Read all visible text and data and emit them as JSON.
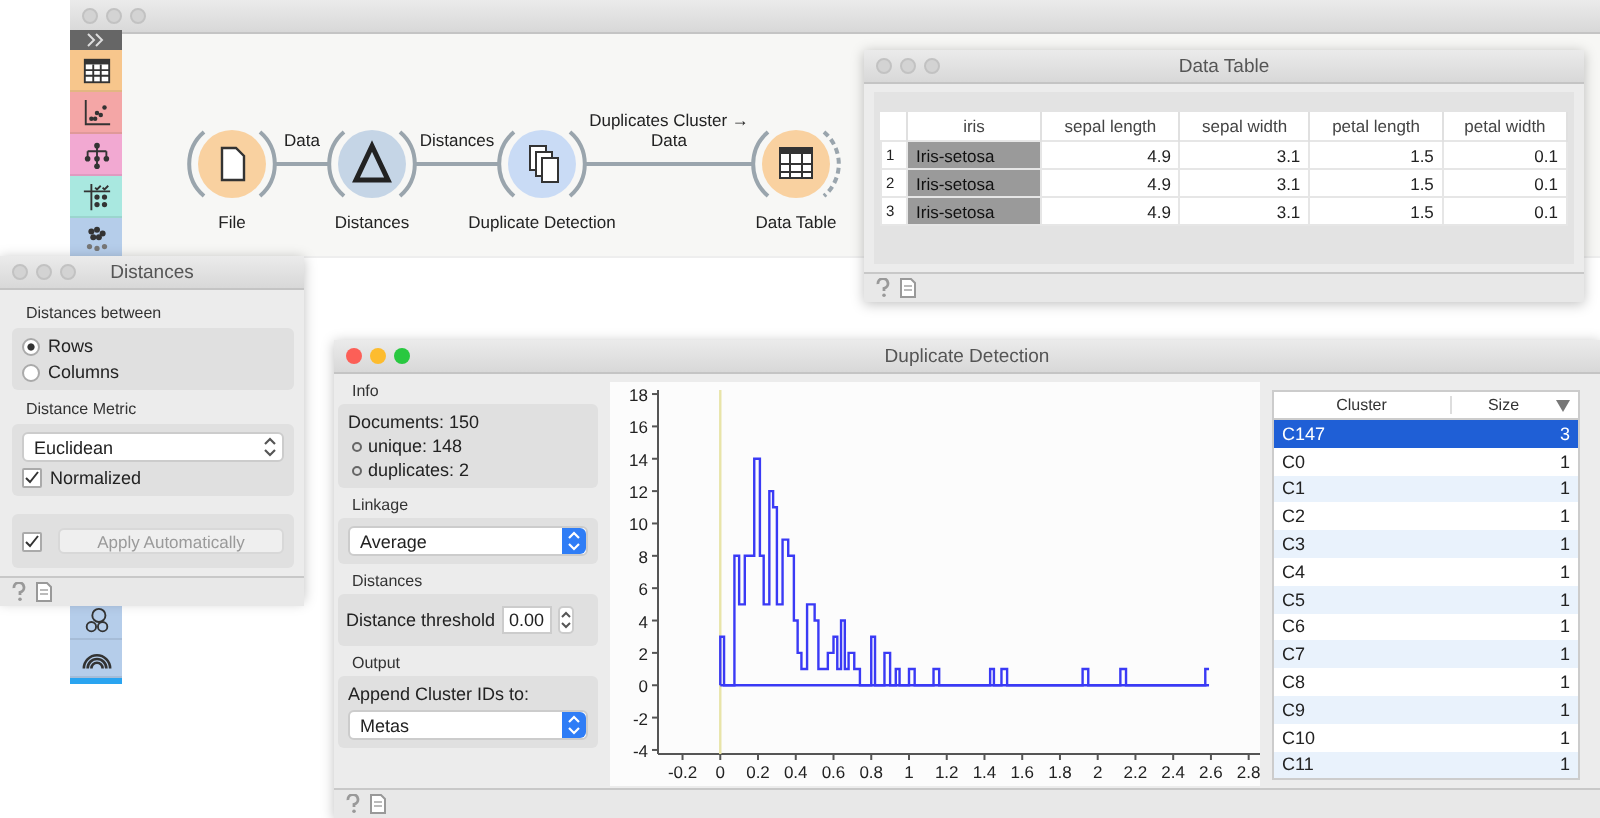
{
  "canvas_window": {
    "toolbox": [
      {
        "kind": "table",
        "color": "#f7c68c"
      },
      {
        "kind": "scatter",
        "color": "#f4a6a6"
      },
      {
        "kind": "tree",
        "color": "#f2a9d2"
      },
      {
        "kind": "grid",
        "color": "#a9e8e0"
      },
      {
        "kind": "cluster",
        "color": "#b5cdea"
      }
    ],
    "toolbox_lower": [
      {
        "kind": "venn",
        "color": "#b5cdea"
      },
      {
        "kind": "rainbow",
        "color": "#b5cdea"
      }
    ],
    "nodes": [
      {
        "label": "File",
        "kind": "file",
        "color": "#f9d1a0"
      },
      {
        "label": "Distances",
        "kind": "delta",
        "color": "#c5d5e6"
      },
      {
        "label": "Duplicate Detection",
        "kind": "pages",
        "color": "#c9dbf5"
      },
      {
        "label": "Data Table",
        "kind": "table",
        "color": "#f9d1a0"
      }
    ],
    "links": [
      {
        "label": "Data"
      },
      {
        "label": "Distances"
      },
      {
        "label": "Duplicates Cluster → Data"
      }
    ]
  },
  "data_table_window": {
    "title": "Data Table",
    "columns": [
      "iris",
      "sepal length",
      "sepal width",
      "petal length",
      "petal width"
    ],
    "rows": [
      {
        "number": "1",
        "cells": [
          "Iris-setosa",
          "4.9",
          "3.1",
          "1.5",
          "0.1"
        ]
      },
      {
        "number": "2",
        "cells": [
          "Iris-setosa",
          "4.9",
          "3.1",
          "1.5",
          "0.1"
        ]
      },
      {
        "number": "3",
        "cells": [
          "Iris-setosa",
          "4.9",
          "3.1",
          "1.5",
          "0.1"
        ]
      }
    ]
  },
  "distances_window": {
    "title": "Distances",
    "between_label": "Distances between",
    "between_options": [
      {
        "label": "Rows",
        "selected": true
      },
      {
        "label": "Columns",
        "selected": false
      }
    ],
    "metric_label": "Distance Metric",
    "metric": "Euclidean",
    "normalized": {
      "label": "Normalized",
      "checked": true
    },
    "apply_auto": {
      "checked": true,
      "label": "Apply Automatically",
      "disabled": true
    }
  },
  "duplicate_window": {
    "title": "Duplicate Detection",
    "info_label": "Info",
    "documents": "Documents: 150",
    "info_items": [
      "unique: 148",
      "duplicates: 2"
    ],
    "linkage_label": "Linkage",
    "linkage": "Average",
    "distances_label": "Distances",
    "threshold_label": "Distance threshold",
    "threshold": "0.00",
    "output_label": "Output",
    "append_label": "Append Cluster IDs to:",
    "append_to": "Metas",
    "chart_data": {
      "type": "line",
      "x": [
        0,
        0,
        0.02,
        0.02,
        0.075,
        0.075,
        0.1,
        0.1,
        0.13,
        0.13,
        0.18,
        0.18,
        0.21,
        0.21,
        0.23,
        0.23,
        0.26,
        0.26,
        0.28,
        0.28,
        0.3,
        0.3,
        0.33,
        0.33,
        0.36,
        0.36,
        0.39,
        0.39,
        0.41,
        0.41,
        0.43,
        0.43,
        0.46,
        0.46,
        0.5,
        0.5,
        0.52,
        0.52,
        0.57,
        0.57,
        0.6,
        0.6,
        0.62,
        0.62,
        0.64,
        0.64,
        0.66,
        0.66,
        0.68,
        0.68,
        0.71,
        0.71,
        0.74,
        0.74,
        0.8,
        0.8,
        0.82,
        0.82,
        0.87,
        0.87,
        0.9,
        0.9,
        0.93,
        0.93,
        0.95,
        0.95,
        1.0,
        1.0,
        1.03,
        1.03,
        1.13,
        1.13,
        1.16,
        1.16,
        1.43,
        1.43,
        1.45,
        1.45,
        1.49,
        1.49,
        1.52,
        1.52,
        1.92,
        1.92,
        1.95,
        1.95,
        2.12,
        2.12,
        2.15,
        2.15,
        2.57,
        2.57,
        2.59
      ],
      "series": [
        {
          "color": "#3a3af5",
          "values": [
            0,
            3,
            3,
            0,
            0,
            8,
            8,
            5,
            5,
            8,
            8,
            14,
            14,
            8,
            8,
            5,
            5,
            12,
            12,
            11,
            11,
            5,
            5,
            9,
            9,
            8,
            8,
            4,
            4,
            2,
            2,
            1,
            1,
            5,
            5,
            4,
            4,
            1,
            1,
            2,
            2,
            3,
            3,
            1,
            1,
            4,
            4,
            1,
            1,
            2,
            2,
            1,
            1,
            0,
            0,
            3,
            3,
            0,
            0,
            2,
            2,
            0,
            0,
            1,
            1,
            0,
            0,
            1,
            1,
            0,
            0,
            1,
            1,
            0,
            0,
            1,
            1,
            0,
            0,
            1,
            1,
            0,
            0,
            1,
            1,
            0,
            0,
            1,
            1,
            0,
            0,
            1,
            1
          ]
        },
        {
          "color": "#3a3af5",
          "values": [
            0,
            0,
            0,
            0,
            0,
            0,
            0,
            0,
            0,
            0,
            0,
            0,
            0,
            0,
            0,
            0,
            0,
            0,
            0,
            0,
            0,
            0,
            0,
            0,
            0,
            0,
            0,
            0,
            0,
            0,
            0,
            0,
            0,
            0,
            0,
            0,
            0,
            0,
            0,
            0,
            0,
            0,
            0,
            0,
            0,
            0,
            0,
            0,
            0,
            0,
            0,
            0,
            0,
            0,
            0,
            0,
            0,
            0,
            0,
            0,
            0,
            0,
            0,
            0,
            0,
            0,
            0,
            0,
            0,
            0,
            0,
            0,
            0,
            0,
            0,
            0,
            0,
            0,
            0,
            0,
            0,
            0,
            0,
            0,
            0,
            0,
            0,
            0,
            0,
            0,
            0,
            0,
            0
          ]
        }
      ],
      "ref_lines": [
        {
          "axis": "x",
          "value": 0,
          "color": "#e8e4a8"
        }
      ],
      "xlim": [
        -0.33,
        2.86
      ],
      "ylim": [
        -4.25,
        18.25
      ],
      "xticks": [
        -0.2,
        0,
        0.2,
        0.4,
        0.6,
        0.8,
        1,
        1.2,
        1.4,
        1.6,
        1.8,
        2,
        2.2,
        2.4,
        2.6,
        2.8
      ],
      "yticks": [
        -4,
        -2,
        0,
        2,
        4,
        6,
        8,
        10,
        12,
        14,
        16,
        18
      ]
    },
    "cluster_columns": [
      "Cluster",
      "Size"
    ],
    "clusters": [
      {
        "name": "C147",
        "size": "3",
        "selected": true
      },
      {
        "name": "C0",
        "size": "1",
        "selected": false
      },
      {
        "name": "C1",
        "size": "1",
        "selected": false
      },
      {
        "name": "C2",
        "size": "1",
        "selected": false
      },
      {
        "name": "C3",
        "size": "1",
        "selected": false
      },
      {
        "name": "C4",
        "size": "1",
        "selected": false
      },
      {
        "name": "C5",
        "size": "1",
        "selected": false
      },
      {
        "name": "C6",
        "size": "1",
        "selected": false
      },
      {
        "name": "C7",
        "size": "1",
        "selected": false
      },
      {
        "name": "C8",
        "size": "1",
        "selected": false
      },
      {
        "name": "C9",
        "size": "1",
        "selected": false
      },
      {
        "name": "C10",
        "size": "1",
        "selected": false
      },
      {
        "name": "C11",
        "size": "1",
        "selected": false
      }
    ]
  }
}
